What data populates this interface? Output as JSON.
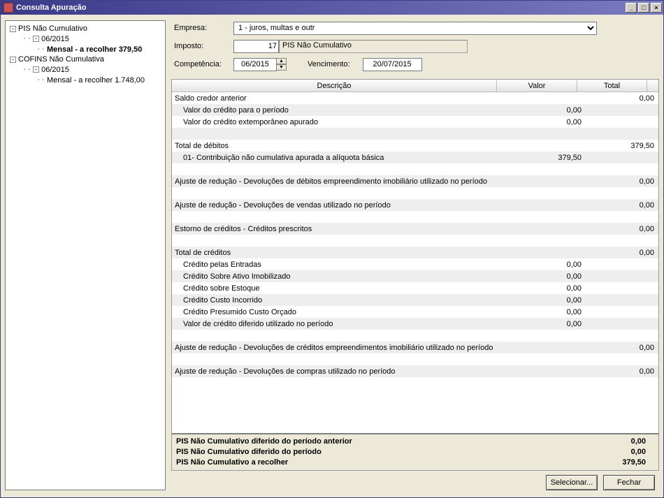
{
  "window": {
    "title": "Consulta Apuração"
  },
  "tree": {
    "nodes": [
      {
        "label": "PIS Não Cumulativo",
        "bold": false,
        "exp": "-",
        "depth": 0
      },
      {
        "label": "06/2015",
        "bold": false,
        "exp": "-",
        "depth": 1
      },
      {
        "label": "Mensal - a recolher 379,50",
        "bold": true,
        "exp": "",
        "depth": 2
      },
      {
        "label": "COFINS Não Cumulativa",
        "bold": false,
        "exp": "-",
        "depth": 0
      },
      {
        "label": "06/2015",
        "bold": false,
        "exp": "-",
        "depth": 1
      },
      {
        "label": "Mensal - a recolher 1.748,00",
        "bold": false,
        "exp": "",
        "depth": 2
      }
    ]
  },
  "header": {
    "empresa_label": "Empresa:",
    "empresa_value": "1 - juros, multas e outr",
    "imposto_label": "Imposto:",
    "imposto_code": "17",
    "imposto_name": "PIS Não Cumulativo",
    "competencia_label": "Competência:",
    "competencia_value": "06/2015",
    "vencimento_label": "Vencimento:",
    "vencimento_value": "20/07/2015"
  },
  "grid": {
    "columns": {
      "descricao": "Descrição",
      "valor": "Valor",
      "total": "Total"
    },
    "rows": [
      {
        "desc": "Saldo credor anterior",
        "valor": "",
        "total": "0,00",
        "indent": false
      },
      {
        "desc": "Valor do crédito para o período",
        "valor": "0,00",
        "total": "",
        "indent": true
      },
      {
        "desc": "Valor do crédito extemporâneo apurado",
        "valor": "0,00",
        "total": "",
        "indent": true
      },
      {
        "desc": "",
        "valor": "",
        "total": "",
        "indent": false
      },
      {
        "desc": "Total de débitos",
        "valor": "",
        "total": "379,50",
        "indent": false
      },
      {
        "desc": "01- Contribuição não cumulativa apurada a alíquota básica",
        "valor": "379,50",
        "total": "",
        "indent": true
      },
      {
        "desc": "",
        "valor": "",
        "total": "",
        "indent": false
      },
      {
        "desc": "Ajuste de redução - Devoluções de débitos empreendimento imobiliário utilizado no período",
        "valor": "",
        "total": "0,00",
        "indent": false
      },
      {
        "desc": "",
        "valor": "",
        "total": "",
        "indent": false
      },
      {
        "desc": "Ajuste de redução - Devoluções de vendas utilizado no período",
        "valor": "",
        "total": "0,00",
        "indent": false
      },
      {
        "desc": "",
        "valor": "",
        "total": "",
        "indent": false
      },
      {
        "desc": "Estorno de créditos - Créditos prescritos",
        "valor": "",
        "total": "0,00",
        "indent": false
      },
      {
        "desc": "",
        "valor": "",
        "total": "",
        "indent": false
      },
      {
        "desc": "Total de créditos",
        "valor": "",
        "total": "0,00",
        "indent": false
      },
      {
        "desc": "Crédito pelas Entradas",
        "valor": "0,00",
        "total": "",
        "indent": true
      },
      {
        "desc": "Crédito Sobre Ativo Imobilizado",
        "valor": "0,00",
        "total": "",
        "indent": true
      },
      {
        "desc": "Crédito sobre Estoque",
        "valor": "0,00",
        "total": "",
        "indent": true
      },
      {
        "desc": "Crédito Custo Incorrido",
        "valor": "0,00",
        "total": "",
        "indent": true
      },
      {
        "desc": "Crédito Presumido Custo Orçado",
        "valor": "0,00",
        "total": "",
        "indent": true
      },
      {
        "desc": "Valor de crédito diferido utilizado no período",
        "valor": "0,00",
        "total": "",
        "indent": true
      },
      {
        "desc": "",
        "valor": "",
        "total": "",
        "indent": false
      },
      {
        "desc": "Ajuste de redução - Devoluções de créditos empreendimentos imobiliário utilizado no período",
        "valor": "",
        "total": "0,00",
        "indent": false
      },
      {
        "desc": "",
        "valor": "",
        "total": "",
        "indent": false
      },
      {
        "desc": "Ajuste de redução - Devoluções de compras utilizado no período",
        "valor": "",
        "total": "0,00",
        "indent": false
      },
      {
        "desc": "",
        "valor": "",
        "total": "",
        "indent": false
      }
    ]
  },
  "summary": {
    "rows": [
      {
        "label": "PIS Não Cumulativo diferido do período anterior",
        "value": "0,00"
      },
      {
        "label": "PIS Não Cumulativo diferido do período",
        "value": "0,00"
      },
      {
        "label": "PIS Não Cumulativo a recolher",
        "value": "379,50"
      }
    ]
  },
  "buttons": {
    "selecionar": "Selecionar...",
    "fechar": "Fechar"
  }
}
